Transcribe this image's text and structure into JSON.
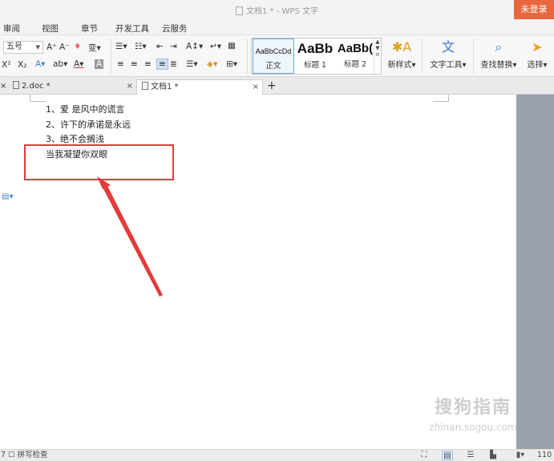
{
  "window": {
    "title": "文档1 * - WPS 文字",
    "login_label": "未登录"
  },
  "menu": {
    "items": [
      "审阅",
      "视图",
      "章节",
      "开发工具",
      "云服务"
    ]
  },
  "ribbon": {
    "font_size": "五号",
    "styles": [
      {
        "preview": "AaBbCcDd",
        "name": "正文"
      },
      {
        "preview": "AaBb",
        "name": "标题 1"
      },
      {
        "preview": "AaBb(",
        "name": "标题 2"
      }
    ],
    "new_style_label": "新样式",
    "text_tools_label": "文字工具",
    "find_replace_label": "查找替换",
    "select_label": "选择"
  },
  "tabs": [
    {
      "label": "2.doc *",
      "active": false
    },
    {
      "label": "文档1 *",
      "active": true
    }
  ],
  "document": {
    "lines": [
      "1、爱 是风中的谎言",
      "2、许下的承诺是永远",
      "3、绝不会搁浅",
      "当我凝望你双眼"
    ]
  },
  "annotation": {
    "color": "#e53a3a"
  },
  "watermark": {
    "main": "搜狗指南",
    "sub": "zhinan.sogou.com"
  },
  "statusbar": {
    "page_fragment": "7",
    "spellcheck_label": "拼写检查",
    "zoom": "110"
  },
  "colors": {
    "login_bg": "#e8673e",
    "side_panel": "#9aa1ad"
  }
}
